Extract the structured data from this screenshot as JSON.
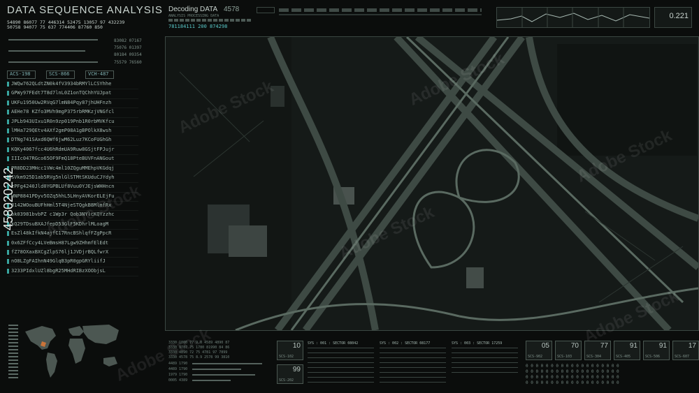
{
  "header": {
    "title": "DATA SEQUENCE ANALYSIS",
    "decoding_label": "Decoding DATA",
    "decoding_value": "4578",
    "analysis_label": "ANALYSIS PROCESSING DATA",
    "analysis_numbers": "781184111 200 874298",
    "num_row1": "54890  86077  77  446314  52475  13057  97  432239",
    "num_row2": "50758  94077  75  637  774406  87760  850",
    "right_readout": "0.221"
  },
  "left": {
    "stats": [
      "83082 07167",
      "75076 01397",
      "80184 09354",
      "75579 76560"
    ],
    "tags": [
      "ACS-198",
      "SCS-866",
      "VCH-487"
    ],
    "code_lines": [
      "JWQw762QLdtZN0k4fV3934bRMYlLCSYhhe",
      "GPWy97FEdt7T8d7lnL0Z1onTQChhYUJpat",
      "UKFu1950Uw2RVqG7lmN84Pqy87jhUHFnzh",
      "AEHe78 KZfo3MVh9mgP375rbRMKzjVNGfcl",
      "JPLb943UIxu1R0n9zp019Pnb1R0rbMVKfcu",
      "lMHa729QEtv4AXf2gmP08A1gBPOlkX8wsh",
      "DTNg741SAxd6QWf6jwM62Luz7KCoFUGhGh",
      "KQKy4067fcc4U6hRdmUA9Ruw8GSjtFPJujr",
      "IIIc047RGco65OF9FmQ18PteBUVFnANGout",
      "PR8DD23MHcc1VWc4ml10ZQguMMEhpVKGdqj",
      "SVkm925D1ab5RVg5nlGlSTMtSKUduCJYdyh",
      "zPFg4240Jld0YGPBLUf8Vuu0YJEjsWHHncn",
      "HNP8841PDyv5OZq5hhL5LHnyAVKorELEjFu",
      "8142WOouBUFhHml5T4NjeSTQgkB8MlmfRx",
      "ok03981bvbPZ c1Wp3r Qob3NYlcKQYzzhc",
      "kQ29TDsuBXAJfepD53GlF5KDhrlMLoagM",
      "EsZl48kIfkN4ajfC17RncBShlqfFZgPpcR",
      "0x6ZFfCcy4LVeBmsH87Lgw9ZHhmfElEdt",
      "fZ78OXaxBXCgZlpS76lj1JVDjrBQLfwrX",
      "nO8LZgFAIhnN49GlqB3pR0gpGRYliifJ",
      "3233PIdxlUZl8bgR25MHdRIBzXOObjsL"
    ],
    "side_id": "458020242"
  },
  "bottom": {
    "block1_rows": [
      "3330  1000  77  9.0  4589  4890  87",
      "3330  9787  75  1780  81990  84  86",
      "3330  4890  72  75  4781  97  7899",
      "3330  4578  75  8.9  2578  99  3810"
    ],
    "meters": [
      "4489 1790",
      "4489 1790",
      "1979 1790",
      "0005 4389"
    ],
    "tile_a": {
      "num": "10",
      "label": "SCS-102"
    },
    "tile_b": {
      "num": "99",
      "label": "SCS-202"
    },
    "sectors": [
      "SYS : 001 : SECTOR 08042",
      "SYS : 002 : SECTOR 08177",
      "SYS : 003 : SECTOR 17259"
    ],
    "right_tiles": [
      {
        "num": "05",
        "label": "SCS-902"
      },
      {
        "num": "70",
        "label": "SCS-103"
      },
      {
        "num": "77",
        "label": "SCS-304"
      },
      {
        "num": "91",
        "label": "SCS-405"
      },
      {
        "num": "91",
        "label": "SCS-506"
      },
      {
        "num": "17",
        "label": "SCS-607"
      }
    ],
    "grid_rows": [
      "0 0 0 0 0 0   0 0 0 0 0 0   0 0 0 0 0 0 0",
      "0 0 0 0 0 0   0 0 0 0 0 0   0 0 0 0 0 0 0",
      "0 0 0 0 0 0   0 0 0 0 0 0   0 0 0 0 0 0 0",
      "0 0 0 0 0 0   0 0 0 0 0 0   0 0 0 0 0 0 0"
    ]
  },
  "watermark": "Adobe Stock",
  "colors": {
    "accent": "#59c9c9",
    "panel": "#0b0d0c",
    "text": "#8fa39b"
  }
}
